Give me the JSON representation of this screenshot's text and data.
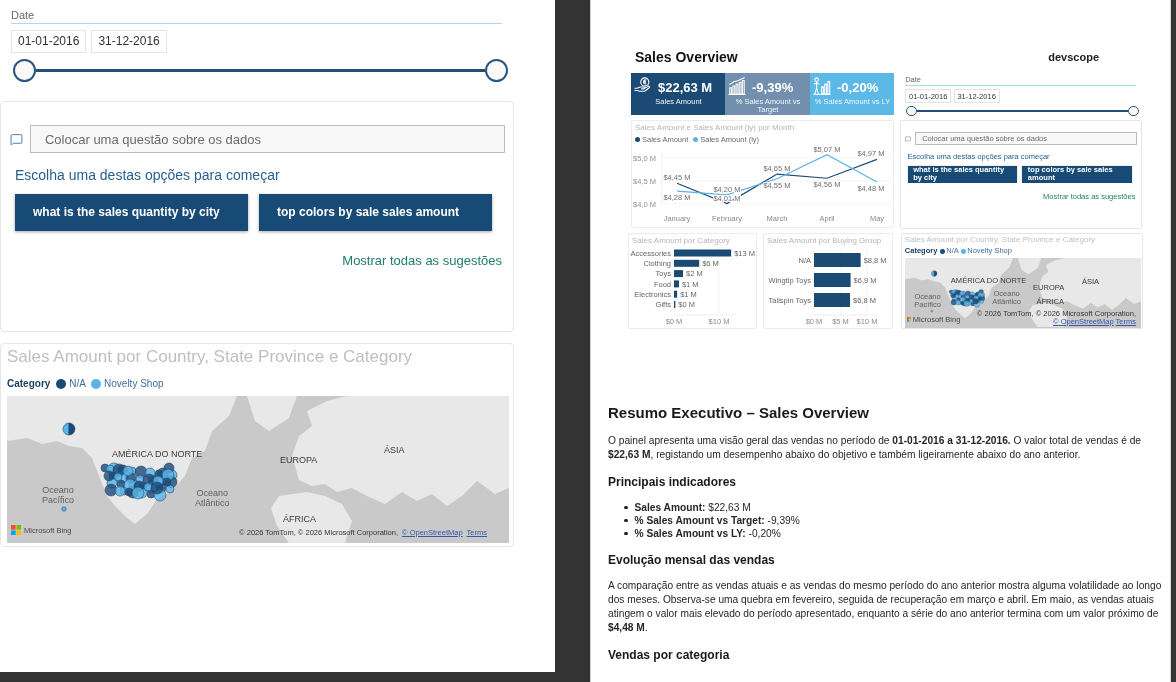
{
  "left_pane": {
    "date_slicer": {
      "label": "Date",
      "start_date": "01-01-2016",
      "end_date": "31-12-2016",
      "handles": [
        {
          "level": 0
        },
        {
          "level": 1
        }
      ]
    },
    "qa": {
      "placeholder": "Colocar uma questão sobre os dados",
      "prompt": "Escolha uma destas opções para começar",
      "suggestions": [
        "what is the sales quantity by city",
        "top colors by sale sales amount"
      ],
      "link": "Mostrar todas as sugestões"
    },
    "map_visual": {
      "title": "Sales Amount por Country, State Province e Category",
      "legend": {
        "title": "Category",
        "items": [
          {
            "label": "N/A",
            "color": "#1b4a75"
          },
          {
            "label": "Novelty Shop",
            "color": "#5ab4e5"
          }
        ]
      },
      "labels": [
        {
          "text": "AMÉRICA DO NORTE",
          "kind": "region"
        },
        {
          "text": "EUROPA",
          "kind": "region"
        },
        {
          "text": "ÁSIA",
          "kind": "region"
        },
        {
          "text": "Oceano Pacífico",
          "kind": "ocean"
        },
        {
          "text": "Oceano Atlântico",
          "kind": "ocean"
        },
        {
          "text": "ÁFRICA",
          "kind": "region"
        }
      ],
      "provider": "Microsoft Bing",
      "attribution": "© 2026 TomTom, © 2026 Microsoft Corporation,",
      "links": [
        "© OpenStreetMap",
        "Terms"
      ]
    }
  },
  "right_pane": {
    "dashboard_preview": {
      "title": "Sales Overview",
      "logo": "devscope",
      "kpis": [
        {
          "value": "$22,63 M",
          "label": "Sales Amount",
          "color": "#1b4a75"
        },
        {
          "value": "-9,39%",
          "label": "% Sales Amount vs Target",
          "color": "#7290ad"
        },
        {
          "value": "-0,20%",
          "label": "% Sales Amount vs LY",
          "color": "#5bb8e7"
        }
      ],
      "line_chart": {
        "chart_data": {
          "type": "line",
          "title": "Sales Amount e Sales Amount (ly) por Month",
          "legend": "top",
          "categories": [
            "January",
            "February",
            "March",
            "April",
            "May"
          ],
          "series": [
            {
              "name": "Sales Amount",
              "color": "#1b4a75",
              "values": [
                4.45,
                4.01,
                4.65,
                4.56,
                4.97
              ]
            },
            {
              "name": "Sales Amount (ly)",
              "color": "#5ab4e5",
              "values": [
                4.28,
                4.2,
                4.55,
                5.07,
                4.48
              ]
            }
          ],
          "ylim": [
            4,
            5.1
          ],
          "yticks": [
            {
              "value": 4,
              "label": "$4,0 M"
            },
            {
              "value": 4.5,
              "label": "$4,5 M"
            },
            {
              "value": 5,
              "label": "$5,0 M"
            }
          ],
          "value_labels": [
            [
              "$4,45 M",
              "$4,01 M",
              "$4,65 M",
              "$4,56 M",
              "$4,97 M"
            ],
            [
              "$4,28 M",
              "$4,20 M",
              "$4,55 M",
              "$5,07 M",
              "$4,48 M"
            ]
          ]
        }
      },
      "date_slicer": {
        "label": "Date",
        "start_date": "01-01-2016",
        "end_date": "31-12-2016",
        "handles": [
          {
            "level": 0
          },
          {
            "level": 1
          }
        ]
      },
      "qa": {
        "placeholder": "Colocar uma questão sobre os dados",
        "prompt": "Escolha uma destas opções para começar",
        "suggestions": [
          "what is the sales quantity by city",
          "top colors by sale sales amount"
        ],
        "link": "Mostrar todas as sugestões"
      },
      "category_chart": {
        "chart_data": {
          "type": "bar",
          "orientation": "horizontal",
          "title": "Sales Amount por Category",
          "categories": [
            "Accessories",
            "Clothing",
            "Toys",
            "Food",
            "Electronics",
            "Gifts"
          ],
          "values": [
            12.7,
            5.6,
            2.0,
            1.1,
            0.7,
            0.3
          ],
          "xlim": [
            0,
            14
          ],
          "xticks": [
            {
              "value": 0,
              "label": "$0 M"
            },
            {
              "value": 10,
              "label": "$10 M"
            }
          ],
          "value_labels": [
            "$13 M",
            "$6 M",
            "$2 M",
            "$1 M",
            "$1 M",
            "$0 M"
          ]
        }
      },
      "buying_group_chart": {
        "chart_data": {
          "type": "bar",
          "orientation": "horizontal",
          "title": "Sales Amount por Buying Group",
          "categories": [
            "N/A",
            "Wingtip Toys",
            "Tailspin Toys"
          ],
          "values": [
            8.8,
            6.9,
            6.8
          ],
          "xlim": [
            0,
            12
          ],
          "xticks": [
            {
              "value": 0,
              "label": "$0 M"
            },
            {
              "value": 5,
              "label": "$5 M"
            },
            {
              "value": 10,
              "label": "$10 M"
            }
          ],
          "value_labels": [
            "$8,8 M",
            "$6,9 M",
            "$6,8 M"
          ]
        }
      },
      "map_visual": {
        "title": "Sales Amount por Country, State Province e Category",
        "legend": {
          "title": "Category",
          "items": [
            {
              "label": "N/A",
              "color": "#1b4a75"
            },
            {
              "label": "Novelty Shop",
              "color": "#5ab4e5"
            }
          ]
        },
        "labels": [
          {
            "text": "AMÉRICA DO NORTE",
            "kind": "region"
          },
          {
            "text": "EUROPA",
            "kind": "region"
          },
          {
            "text": "ÁSIA",
            "kind": "region"
          },
          {
            "text": "Oceano Pacífico",
            "kind": "ocean"
          },
          {
            "text": "Oceano Atlântico",
            "kind": "ocean"
          },
          {
            "text": "ÁFRICA",
            "kind": "region"
          }
        ],
        "provider": "Microsoft Bing",
        "attribution": "© 2026 TomTom, © 2026 Microsoft Corporation,",
        "links": [
          "© OpenStreetMap",
          "Terms"
        ]
      }
    },
    "report": {
      "title": "Resumo Executivo – Sales Overview",
      "sections": [
        {
          "kind": "paragraph",
          "text": "O painel apresenta uma visão geral das vendas no período de **01-01-2016 a 31-12-2016.** O valor total de vendas é de **$22,63 M**, registando um desempenho abaixo do objetivo e também ligeiramente abaixo do ano anterior."
        },
        {
          "kind": "heading",
          "text": "Principais indicadores"
        },
        {
          "kind": "bullets",
          "items": [
            "**Sales Amount:** $22,63 M",
            "**% Sales Amount vs Target:** -9,39%",
            "**% Sales Amount vs LY:** -0,20%"
          ]
        },
        {
          "kind": "heading",
          "text": "Evolução mensal das vendas"
        },
        {
          "kind": "paragraph",
          "text": "A comparação entre as vendas atuais e as vendas do mesmo período do ano anterior mostra alguma volatilidade ao longo dos meses. Observa-se uma quebra em fevereiro, seguida de recuperação em março e abril. Em maio, as vendas atuais atingem o valor mais elevado do período apresentado, enquanto a série do ano anterior termina com um valor próximo de **$4,48 M**."
        },
        {
          "kind": "heading",
          "text": "Vendas por categoria"
        }
      ]
    }
  }
}
